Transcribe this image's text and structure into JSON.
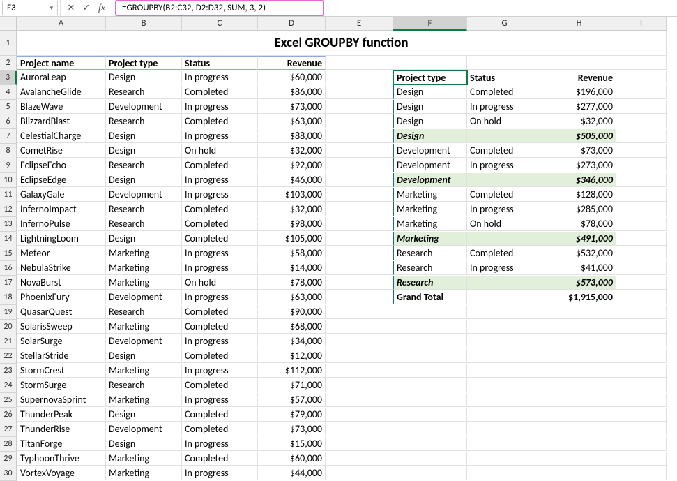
{
  "formula_bar": {
    "name_box": "F3",
    "cancel_icon": "✕",
    "enter_icon": "✓",
    "fx_label": "fx",
    "formula": "=GROUPBY(B2:C32, D2:D32, SUM, 3, 2)"
  },
  "columns": [
    "A",
    "B",
    "C",
    "D",
    "E",
    "F",
    "G",
    "H",
    "I"
  ],
  "row_start": 1,
  "row_end": 30,
  "title": "Excel GROUPBY function",
  "left_headers": {
    "name": "Project name",
    "type": "Project type",
    "status": "Status",
    "revenue": "Revenue"
  },
  "left_rows": [
    {
      "name": "AuroraLeap",
      "type": "Design",
      "status": "In progress",
      "revenue": "$60,000"
    },
    {
      "name": "AvalancheGlide",
      "type": "Research",
      "status": "Completed",
      "revenue": "$86,000"
    },
    {
      "name": "BlazeWave",
      "type": "Development",
      "status": "In progress",
      "revenue": "$73,000"
    },
    {
      "name": "BlizzardBlast",
      "type": "Research",
      "status": "Completed",
      "revenue": "$63,000"
    },
    {
      "name": "CelestialCharge",
      "type": "Design",
      "status": "In progress",
      "revenue": "$88,000"
    },
    {
      "name": "CometRise",
      "type": "Design",
      "status": "On hold",
      "revenue": "$32,000"
    },
    {
      "name": "EclipseEcho",
      "type": "Research",
      "status": "Completed",
      "revenue": "$92,000"
    },
    {
      "name": "EclipseEdge",
      "type": "Design",
      "status": "In progress",
      "revenue": "$46,000"
    },
    {
      "name": "GalaxyGale",
      "type": "Development",
      "status": "In progress",
      "revenue": "$103,000"
    },
    {
      "name": "InfernoImpact",
      "type": "Research",
      "status": "Completed",
      "revenue": "$32,000"
    },
    {
      "name": "InfernoPulse",
      "type": "Research",
      "status": "Completed",
      "revenue": "$98,000"
    },
    {
      "name": "LightningLoom",
      "type": "Design",
      "status": "Completed",
      "revenue": "$105,000"
    },
    {
      "name": "Meteor",
      "type": "Marketing",
      "status": "In progress",
      "revenue": "$58,000"
    },
    {
      "name": "NebulaStrike",
      "type": "Marketing",
      "status": "In progress",
      "revenue": "$14,000"
    },
    {
      "name": "NovaBurst",
      "type": "Marketing",
      "status": "On hold",
      "revenue": "$78,000"
    },
    {
      "name": "PhoenixFury",
      "type": "Development",
      "status": "In progress",
      "revenue": "$63,000"
    },
    {
      "name": "QuasarQuest",
      "type": "Research",
      "status": "Completed",
      "revenue": "$90,000"
    },
    {
      "name": "SolarisSweep",
      "type": "Marketing",
      "status": "Completed",
      "revenue": "$68,000"
    },
    {
      "name": "SolarSurge",
      "type": "Development",
      "status": "In progress",
      "revenue": "$34,000"
    },
    {
      "name": "StellarStride",
      "type": "Design",
      "status": "Completed",
      "revenue": "$12,000"
    },
    {
      "name": "StormCrest",
      "type": "Marketing",
      "status": "In progress",
      "revenue": "$112,000"
    },
    {
      "name": "StormSurge",
      "type": "Research",
      "status": "Completed",
      "revenue": "$71,000"
    },
    {
      "name": "SupernovaSprint",
      "type": "Marketing",
      "status": "In progress",
      "revenue": "$57,000"
    },
    {
      "name": "ThunderPeak",
      "type": "Design",
      "status": "Completed",
      "revenue": "$79,000"
    },
    {
      "name": "ThunderRise",
      "type": "Development",
      "status": "Completed",
      "revenue": "$73,000"
    },
    {
      "name": "TitanForge",
      "type": "Design",
      "status": "In progress",
      "revenue": "$15,000"
    },
    {
      "name": "TyphoonThrive",
      "type": "Marketing",
      "status": "Completed",
      "revenue": "$60,000"
    },
    {
      "name": "VortexVoyage",
      "type": "Marketing",
      "status": "In progress",
      "revenue": "$44,000"
    }
  ],
  "right_headers": {
    "type": "Project type",
    "status": "Status",
    "revenue": "Revenue"
  },
  "right_rows": [
    {
      "kind": "detail",
      "type": "Design",
      "status": "Completed",
      "revenue": "$196,000"
    },
    {
      "kind": "detail",
      "type": "Design",
      "status": "In progress",
      "revenue": "$277,000"
    },
    {
      "kind": "detail",
      "type": "Design",
      "status": "On hold",
      "revenue": "$32,000"
    },
    {
      "kind": "subtotal",
      "type": "Design",
      "status": "",
      "revenue": "$505,000"
    },
    {
      "kind": "detail",
      "type": "Development",
      "status": "Completed",
      "revenue": "$73,000"
    },
    {
      "kind": "detail",
      "type": "Development",
      "status": "In progress",
      "revenue": "$273,000"
    },
    {
      "kind": "subtotal",
      "type": "Development",
      "status": "",
      "revenue": "$346,000"
    },
    {
      "kind": "detail",
      "type": "Marketing",
      "status": "Completed",
      "revenue": "$128,000"
    },
    {
      "kind": "detail",
      "type": "Marketing",
      "status": "In progress",
      "revenue": "$285,000"
    },
    {
      "kind": "detail",
      "type": "Marketing",
      "status": "On hold",
      "revenue": "$78,000"
    },
    {
      "kind": "subtotal",
      "type": "Marketing",
      "status": "",
      "revenue": "$491,000"
    },
    {
      "kind": "detail",
      "type": "Research",
      "status": "Completed",
      "revenue": "$532,000"
    },
    {
      "kind": "detail",
      "type": "Research",
      "status": "In progress",
      "revenue": "$41,000"
    },
    {
      "kind": "subtotal",
      "type": "Research",
      "status": "",
      "revenue": "$573,000"
    },
    {
      "kind": "grandtotal",
      "type": "Grand Total",
      "status": "",
      "revenue": "$1,915,000"
    }
  ]
}
